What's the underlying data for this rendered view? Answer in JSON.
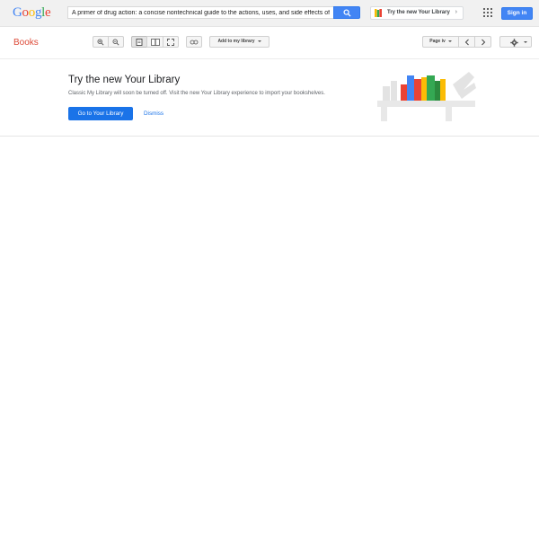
{
  "header": {
    "logo_letters": [
      {
        "ch": "G",
        "color": "#4285f4"
      },
      {
        "ch": "o",
        "color": "#ea4335"
      },
      {
        "ch": "o",
        "color": "#fbbc05"
      },
      {
        "ch": "g",
        "color": "#4285f4"
      },
      {
        "ch": "l",
        "color": "#34a853"
      },
      {
        "ch": "e",
        "color": "#ea4335"
      }
    ],
    "search_value": "A primer of drug action: a concise nontechnical guide to the actions, uses, and side effects of psychoactive drugs",
    "try_library_label": "Try the new Your Library",
    "signin_label": "Sign in"
  },
  "toolbar": {
    "title": "Books",
    "add_to_library_label": "Add to my library",
    "page_label": "Page iv"
  },
  "banner": {
    "title": "Try the new Your Library",
    "description": "Classic My Library will soon be turned off. Visit the new Your Library experience to import your bookshelves.",
    "primary_button": "Go to Your Library",
    "dismiss": "Dismiss"
  },
  "icons": [
    "search-icon",
    "library-icon",
    "chevron-right-icon",
    "apps-icon",
    "zoom-in-icon",
    "zoom-out-icon",
    "single-page-icon",
    "two-page-icon",
    "fullscreen-icon",
    "link-icon",
    "prev-page-icon",
    "next-page-icon",
    "gear-icon",
    "bookshelf-illustration"
  ],
  "colors": {
    "accent_blue": "#4285f4",
    "books_red": "#dd4b39",
    "link_blue": "#1a73e8"
  }
}
